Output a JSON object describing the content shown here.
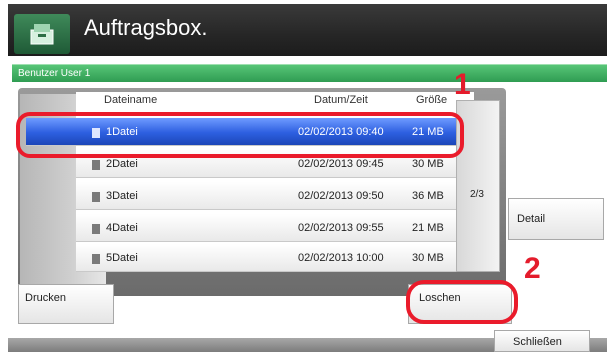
{
  "header": {
    "title": "Auftragsbox."
  },
  "userbar": {
    "label": "Benutzer User 1"
  },
  "columns": {
    "name": "Dateiname",
    "datetime": "Datum/Zeit",
    "size": "Größe"
  },
  "files": [
    {
      "name": "1Datei",
      "datetime": "02/02/2013 09:40",
      "size": "21 MB"
    },
    {
      "name": "2Datei",
      "datetime": "02/02/2013 09:45",
      "size": "30 MB"
    },
    {
      "name": "3Datei",
      "datetime": "02/02/2013 09:50",
      "size": "36 MB"
    },
    {
      "name": "4Datei",
      "datetime": "02/02/2013 09:55",
      "size": "21 MB"
    },
    {
      "name": "5Datei",
      "datetime": "02/02/2013 10:00",
      "size": "30 MB"
    }
  ],
  "pagination": {
    "indicator": "2/3"
  },
  "buttons": {
    "detail": "Detail",
    "print": "Drucken",
    "delete": "Loschen",
    "close": "Schließen"
  },
  "annotations": {
    "one": "1",
    "two": "2"
  },
  "colors": {
    "selection": "#2d5fe0",
    "accent_green": "#2f9c52",
    "annotation_red": "#e41c2c"
  },
  "icons": {
    "logo": "box-icon",
    "file": "document-icon"
  }
}
